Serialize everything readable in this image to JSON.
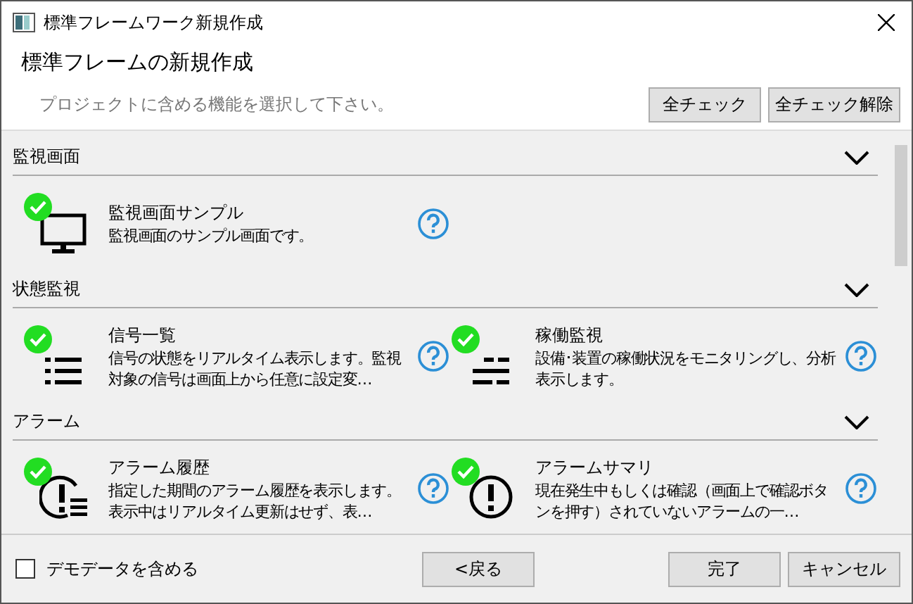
{
  "window": {
    "title": "標準フレームワーク新規作成"
  },
  "header": {
    "title": "標準フレームの新規作成",
    "subtitle": "プロジェクトに含める機能を選択して下さい。",
    "buttons": [
      "全チェック",
      "全チェック解除"
    ]
  },
  "sections": [
    {
      "title": "監視画面",
      "expanded": true,
      "items": [
        {
          "kind": "monitor",
          "checked": true,
          "title": "監視画面サンプル",
          "description": "監視画面のサンプル画面です。"
        }
      ]
    },
    {
      "title": "状態監視",
      "expanded": true,
      "items": [
        {
          "kind": "list",
          "checked": true,
          "title": "信号一覧",
          "description": "信号の状態をリアルタイム表示します。監視対象の信号は画面上から任意に設定変…"
        },
        {
          "kind": "dashes",
          "checked": true,
          "title": "稼働監視",
          "description": "設備･装置の稼働状況をモニタリングし、分析表示します。"
        }
      ]
    },
    {
      "title": "アラーム",
      "expanded": true,
      "items": [
        {
          "kind": "alarm-list",
          "checked": true,
          "title": "アラーム履歴",
          "description": "指定した期間のアラーム履歴を表示します。表示中はリアルタイム更新はせず、表…"
        },
        {
          "kind": "alarm",
          "checked": true,
          "title": "アラームサマリ",
          "description": "現在発生中もしくは確認（画面上で確認ボタンを押す）されていないアラームの一…"
        }
      ]
    }
  ],
  "footer": {
    "demo_data": {
      "label": "デモデータを含める",
      "checked": false
    },
    "back": "<戻る",
    "finish": "完了",
    "cancel": "キャンセル"
  }
}
